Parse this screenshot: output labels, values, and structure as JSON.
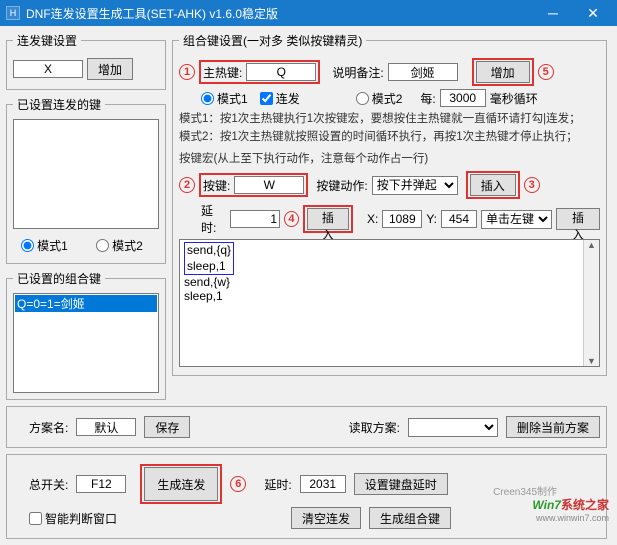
{
  "window": {
    "title": "DNF连发设置生成工具(SET-AHK) v1.6.0稳定版",
    "icon_letter": "H"
  },
  "left": {
    "group1_title": "连发键设置",
    "key_value": "X",
    "add_btn": "增加",
    "group2_title": "已设置连发的键",
    "mode1": "模式1",
    "mode2": "模式2",
    "group3_title": "已设置的组合键",
    "combo_item": "Q=0=1=剑姬"
  },
  "right": {
    "group_title": "组合键设置(一对多 类似按键精灵)",
    "main_hotkey_label": "主热键:",
    "main_hotkey_value": "Q",
    "note_label": "说明备注:",
    "note_value": "剑姬",
    "add_btn": "增加",
    "mode1": "模式1",
    "repeat": "连发",
    "mode2": "模式2",
    "every": "每:",
    "every_value": "3000",
    "every_unit": "毫秒循环",
    "desc1": "模式1：按1次主热键执行1次按键宏，要想按住主热键就一直循环请打勾|连发；",
    "desc2": "模式2：按1次主热键就按照设置的时间循环执行，再按1次主热键才停止执行；",
    "macro_title": "按键宏(从上至下执行动作，注意每个动作占一行)",
    "key_label": "按键:",
    "key_value": "W",
    "key_action_label": "按键动作:",
    "key_action_value": "按下并弹起",
    "insert1": "插入",
    "delay_label": "延时:",
    "delay_value": "1",
    "insert2": "插入",
    "x_label": "X:",
    "x_value": "1089",
    "y_label": "Y:",
    "y_value": "454",
    "click_value": "单击左键",
    "insert3": "插入",
    "script_lines": [
      "send,{q}",
      "sleep,1",
      "send,{w}",
      "sleep,1"
    ]
  },
  "scheme": {
    "name_label": "方案名:",
    "name_value": "默认",
    "save": "保存",
    "load_label": "读取方案:",
    "delete": "删除当前方案"
  },
  "bottom": {
    "master_label": "总开关:",
    "master_value": "F12",
    "gen": "生成连发",
    "smart": "智能判断窗口",
    "delay_label": "延时:",
    "delay_value": "2031",
    "set_kb_delay": "设置键盘延时",
    "clear": "清空连发",
    "gen_combo": "生成组合键"
  },
  "marks": {
    "m1": "1",
    "m2": "2",
    "m3": "3",
    "m4": "4",
    "m5": "5",
    "m6": "6"
  },
  "watermark": {
    "credit": "Creen345制作",
    "brand1": "Win7",
    "brand2": "系统之家",
    "url": "www.winwin7.com"
  }
}
